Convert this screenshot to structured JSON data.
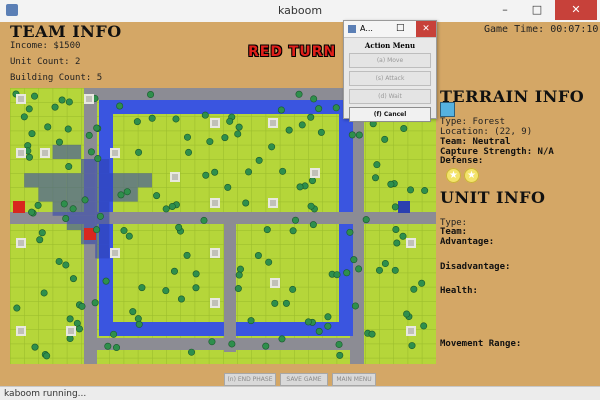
{
  "window": {
    "title": "kaboom",
    "min_label": "–",
    "max_label": "□",
    "close_label": "✕"
  },
  "game_time": "Game Time: 00:07:10",
  "team_info": {
    "title": "TEAM INFO",
    "income": "Income: $1500",
    "unit_count": "Unit Count: 2",
    "building_count": "Building Count: 5"
  },
  "turn_banner": "RED TURN",
  "action_menu": {
    "window_title": "A...",
    "heading": "Action Menu",
    "close_label": "✕",
    "buttons": [
      {
        "label": "(a) Move",
        "enabled": false
      },
      {
        "label": "(s) Attack",
        "enabled": false
      },
      {
        "label": "(d) Wait",
        "enabled": false
      },
      {
        "label": "(f) Cancel",
        "enabled": true
      }
    ]
  },
  "terrain_info": {
    "title": "TERRAIN INFO",
    "type": "Type: Forest",
    "location": "Location: (22, 9)",
    "team": "Team: Neutral",
    "capture": "Capture Strength: N/A",
    "defense_label": "Defense:",
    "defense_stars": 2,
    "icon": "forest-tile-icon"
  },
  "unit_info": {
    "title": "UNIT INFO",
    "type": "Type:",
    "team": "Team:",
    "advantage": "Advantage:",
    "disadvantage": "Disadvantage:",
    "health": "Health:",
    "movement": "Movement Range:"
  },
  "bottom_buttons": {
    "end_phase": "(n) END PHASE",
    "save_game": "SAVE GAME",
    "main_menu": "MAIN MENU"
  },
  "status": "kaboom running...",
  "colors": {
    "background": "#d4a766",
    "grass": "#b5d63a",
    "water": "#3a55e0",
    "road": "#8c8c94",
    "red_team": "#d8271e",
    "blue_team": "#2b3fb0"
  }
}
